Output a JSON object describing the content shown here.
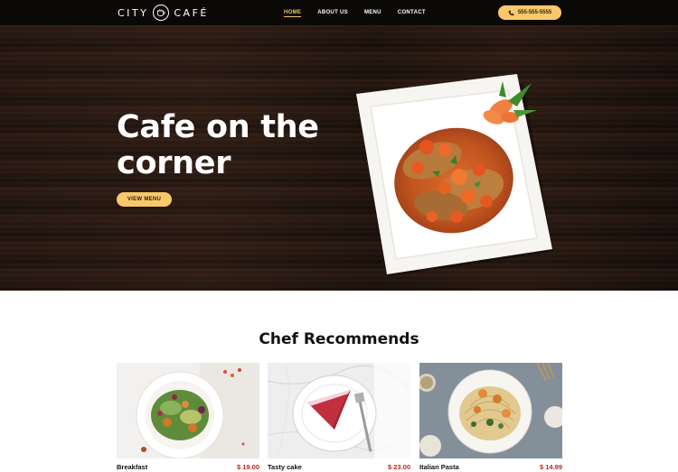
{
  "brand": {
    "left": "CITY",
    "right": "CAFÉ"
  },
  "nav": {
    "items": [
      {
        "label": "HOME",
        "active": true
      },
      {
        "label": "ABOUT US",
        "active": false
      },
      {
        "label": "MENU",
        "active": false
      },
      {
        "label": "CONTACT",
        "active": false
      }
    ],
    "phone": "555-555-5555"
  },
  "hero": {
    "title_line1": "Cafe on the",
    "title_line2": "corner",
    "button": "VIEW MENU"
  },
  "recommend": {
    "title": "Chef Recommends",
    "items": [
      {
        "name": "Breakfast",
        "price": "$ 19.00"
      },
      {
        "name": "Tasty cake",
        "price": "$ 23.00"
      },
      {
        "name": "Italian Pasta",
        "price": "$ 14.99"
      }
    ]
  },
  "colors": {
    "accent": "#f9c86a",
    "nav_bg": "#0b0907",
    "price": "#c0281c",
    "active_nav": "#f4c55e"
  },
  "icons": [
    "coffee-cup-icon",
    "phone-icon"
  ]
}
